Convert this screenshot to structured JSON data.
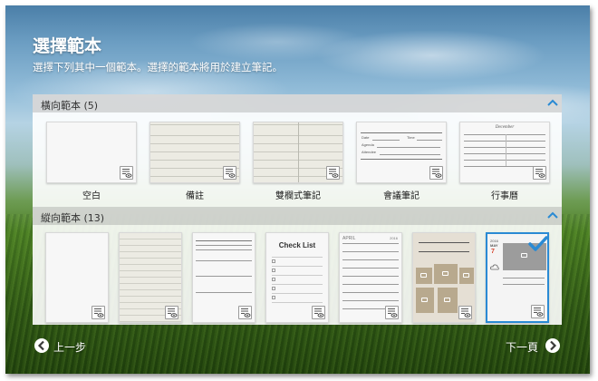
{
  "header": {
    "title": "選擇範本",
    "subtitle": "選擇下列其中一個範本。選擇的範本將用於建立筆記。"
  },
  "landscape": {
    "header_label": "橫向範本 (5)",
    "templates": [
      {
        "label": "空白"
      },
      {
        "label": "備註"
      },
      {
        "label": "雙欄式筆記"
      },
      {
        "label": "會議筆記",
        "fields": [
          "Date",
          "Time",
          "Agenda",
          "Attendee"
        ]
      },
      {
        "label": "行事曆",
        "month": "December"
      }
    ]
  },
  "portrait": {
    "header_label": "縱向範本 (13)",
    "checklist_title": "Check List",
    "diary_month": "APRIL",
    "diary_year": "2016",
    "selected_month": "MAY",
    "selected_day": "7"
  },
  "nav": {
    "back_label": "上一步",
    "next_label": "下一頁"
  },
  "colors": {
    "accent": "#2a8ad4",
    "section_header_bg": "#d7d7d7",
    "text_white": "#ffffff"
  },
  "icons": {
    "preview": "preview-eye-icon",
    "collapse": "chevron-up-icon",
    "back": "chevron-left-icon",
    "next": "chevron-right-icon",
    "selected": "checkmark-icon",
    "photo": "camera-icon",
    "weather": "cloud-icon"
  }
}
